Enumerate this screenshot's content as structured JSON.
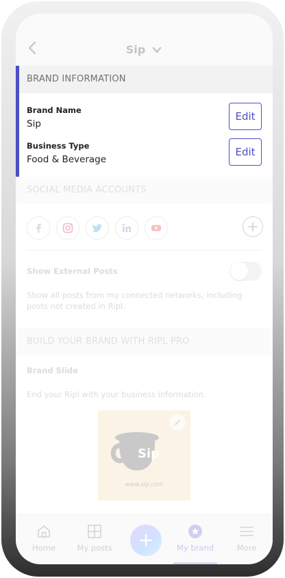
{
  "header": {
    "title": "Sip"
  },
  "brand_info": {
    "section_title": "BRAND INFORMATION",
    "brand_name_label": "Brand Name",
    "brand_name_value": "Sip",
    "business_type_label": "Business Type",
    "business_type_value": "Food & Beverage",
    "edit_label": "Edit"
  },
  "social": {
    "section_title": "SOCIAL MEDIA ACCOUNTS",
    "networks": [
      "facebook",
      "instagram",
      "twitter",
      "linkedin",
      "youtube"
    ],
    "show_external_label": "Show External Posts",
    "show_external_enabled": false,
    "show_external_desc": "Show all posts from my connected networks, including posts not created in Ripl."
  },
  "pro": {
    "section_title": "BUILD YOUR BRAND WITH RIPL PRO",
    "brand_slide_label": "Brand Slide",
    "brand_slide_desc": "End your Ripl with your business information.",
    "slide_logo_text": "Sip",
    "slide_url": "www.sip.com"
  },
  "tabbar": {
    "home": "Home",
    "my_posts": "My posts",
    "my_brand": "My brand",
    "more": "More",
    "active": "my_brand"
  },
  "colors": {
    "accent": "#4a4fc6",
    "instagram": "#e4405f",
    "youtube": "#ff0000"
  }
}
